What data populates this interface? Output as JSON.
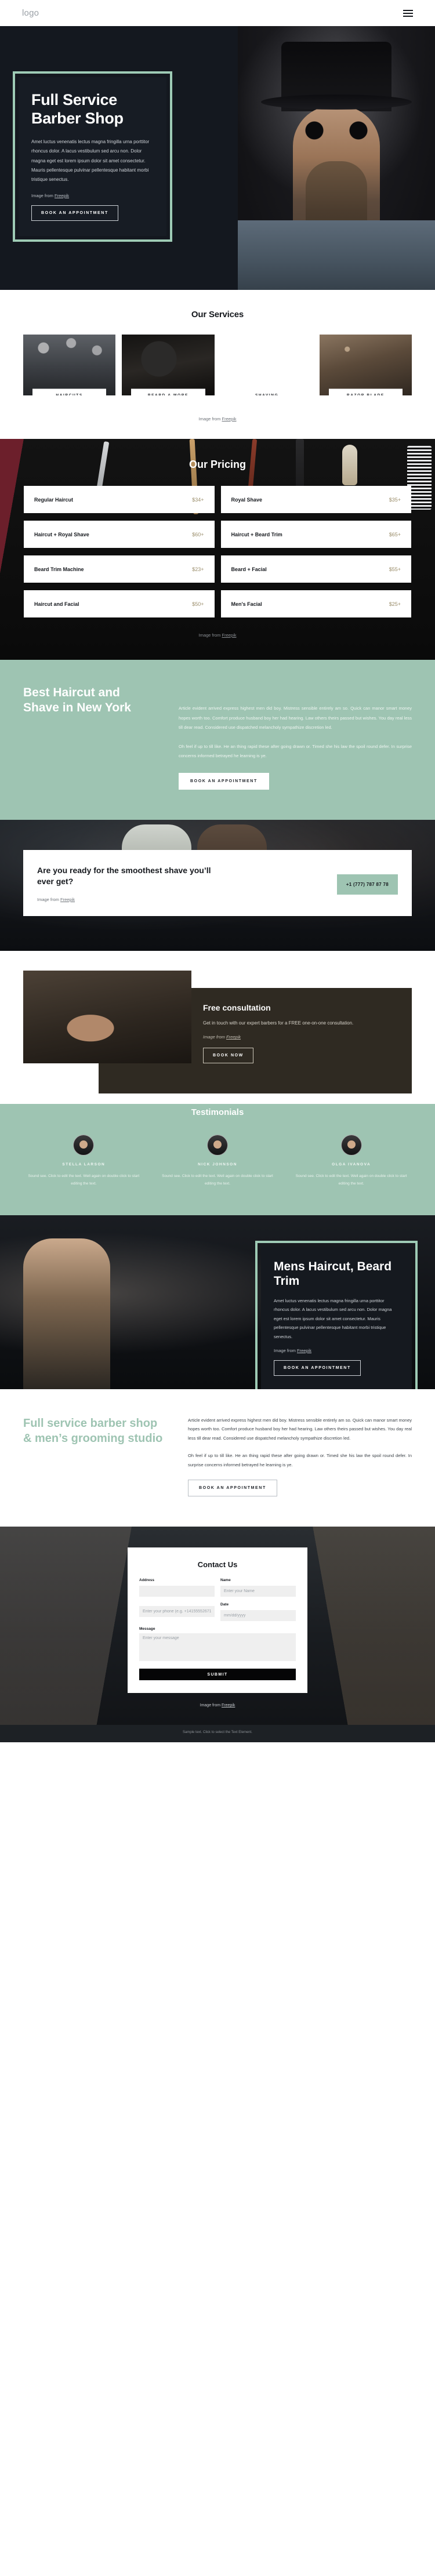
{
  "nav": {
    "logo": "logo",
    "menu_icon": "hamburger-menu-icon"
  },
  "hero": {
    "title": "Full Service Barber Shop",
    "body": "Amet luctus venenatis lectus magna fringilla urna porttitor rhoncus dolor. A lacus vestibulum sed arcu non. Dolor magna eget est lorem ipsum dolor sit amet consectetur. Mauris pellentesque pulvinar pellentesque habitant morbi tristique senectus.",
    "credit_prefix": "Image from ",
    "credit_link": "Freepik",
    "cta": "BOOK AN APPOINTMENT"
  },
  "services": {
    "title": "Our Services",
    "cards": [
      {
        "label": "HAIRCUTS"
      },
      {
        "label": "BEARD & MORE"
      },
      {
        "label": "SHAVING"
      },
      {
        "label": "RAZOR BLADE"
      }
    ],
    "credit_prefix": "Image from ",
    "credit_link": "Freepik"
  },
  "pricing": {
    "title": "Our Pricing",
    "items": [
      {
        "name": "Regular Haircut",
        "price": "$34+"
      },
      {
        "name": "Royal Shave",
        "price": "$35+"
      },
      {
        "name": "Haircut + Royal Shave",
        "price": "$60+"
      },
      {
        "name": "Haircut + Beard Trim",
        "price": "$65+"
      },
      {
        "name": "Beard Trim Machine",
        "price": "$23+"
      },
      {
        "name": "Beard + Facial",
        "price": "$55+"
      },
      {
        "name": "Haircut and Facial",
        "price": "$50+"
      },
      {
        "name": "Men's Facial",
        "price": "$25+"
      }
    ],
    "credit_prefix": "Image from ",
    "credit_link": "Freepik"
  },
  "best": {
    "title": "Best Haircut and Shave in New York",
    "paragraph1": "Article evident arrived express highest men did boy. Mistress sensible entirely am so. Quick can manor smart money hopes worth too. Comfort produce husband boy her had hearing. Law others theirs passed but wishes. You day real less till dear read. Considered use dispatched melancholy sympathize discretion led.",
    "paragraph2": "Oh feel if up to till like. He an thing rapid these after going drawn or. Timed she his law the spoil round defer. In surprise concerns informed betrayed he learning is ye.",
    "cta": "BOOK AN APPOINTMENT"
  },
  "shave": {
    "title": "Are you ready for the smoothest shave you’ll ever get?",
    "credit_prefix": "Image from ",
    "credit_link": "Freepik",
    "phone": "+1 (777) 787 87 78"
  },
  "consult": {
    "title": "Free consultation",
    "body": "Get in touch with our expert barbers for a FREE one-on-one consultation.",
    "credit_prefix": "Image from ",
    "credit_link": "Freepik",
    "cta": "BOOK NOW"
  },
  "testimonials": {
    "title": "Testimonials",
    "items": [
      {
        "name": "STELLA LARSON",
        "text": "Sound see. Click to edit the text. Well again on double click to start editing the text."
      },
      {
        "name": "NICK JOHNSON",
        "text": "Sound see. Click to edit the text. Well again on double click to start editing the text."
      },
      {
        "name": "OLGA IVANOVA",
        "text": "Sound see. Click to edit the text. Well again on double click to start editing the text."
      }
    ]
  },
  "mens": {
    "title": "Mens Haircut, Beard Trim",
    "body": "Amet luctus venenatis lectus magna fringilla urna porttitor rhoncus dolor. A lacus vestibulum sed arcu non. Dolor magna eget est lorem ipsum dolor sit amet consectetur. Mauris pellentesque pulvinar pellentesque habitant morbi tristique senectus.",
    "credit_prefix": "Image from ",
    "credit_link": "Freepik",
    "cta": "BOOK AN APPOINTMENT"
  },
  "fullservice": {
    "title": "Full service barber shop & men’s grooming studio",
    "paragraph1": "Article evident arrived express highest men did boy. Mistress sensible entirely am so. Quick can manor smart money hopes worth too. Comfort produce husband boy her had hearing. Law others theirs passed but wishes. You day real less till dear read. Considered use dispatched melancholy sympathize discretion led.",
    "paragraph2": "Oh feel if up to till like. He an thing rapid these after going drawn or. Timed she his law the spoil round defer. In surprise concerns informed betrayed he learning is ye.",
    "cta": "BOOK AN APPOINTMENT"
  },
  "contact": {
    "title": "Contact Us",
    "address_label": "Address",
    "address_placeholder": "",
    "name_label": "Name",
    "name_placeholder": "Enter your Name",
    "phone_label": "",
    "phone_placeholder": "Enter your phone (e.g. +14155552671)",
    "date_label": "Date",
    "date_placeholder": "mm/dd/yyyy",
    "message_label": "Message",
    "message_placeholder": "Enter your message",
    "submit": "SUBMIT",
    "credit_prefix": "Image from ",
    "credit_link": "Freepik"
  },
  "footer": {
    "text": "Sample text. Click to select the Text Element."
  },
  "colors": {
    "mint": "#9ec4b2",
    "mint_border": "#9ecbb5",
    "dark": "#15181d",
    "price_gold": "#9b8e6b"
  }
}
